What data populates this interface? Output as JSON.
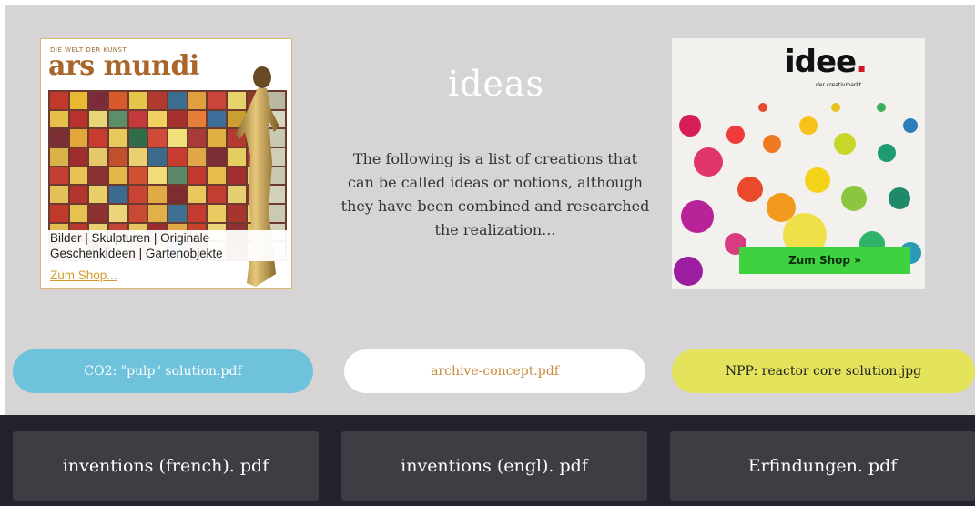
{
  "ads": {
    "left": {
      "brand_small": "DIE WELT DER KUNST",
      "brand": "ars mundi",
      "line1": "Bilder | Skulpturen | Originale",
      "line2": "Geschenkideen | Gartenobjekte",
      "link": "Zum Shop..."
    },
    "right": {
      "logo": "idee",
      "logo_dot": ".",
      "logo_sub": "der creativmarkt",
      "button": "Zum Shop »",
      "button_color": "#3ed240"
    }
  },
  "intro": {
    "title": "ideas",
    "description": "The following is a list of creations that can be called ideas or notions, although they have been combined and researched the realization..."
  },
  "files": [
    {
      "label": "CO2: \"pulp\" solution.pdf",
      "color": "#6fc2dc"
    },
    {
      "label": "archive-concept.pdf",
      "color": "#ffffff"
    },
    {
      "label": "NPP: reactor core solution.jpg",
      "color": "#e4e35c"
    }
  ],
  "downloads": [
    {
      "label": "inventions (french). pdf"
    },
    {
      "label": "inventions (engl). pdf"
    },
    {
      "label": "Erfindungen. pdf"
    }
  ]
}
